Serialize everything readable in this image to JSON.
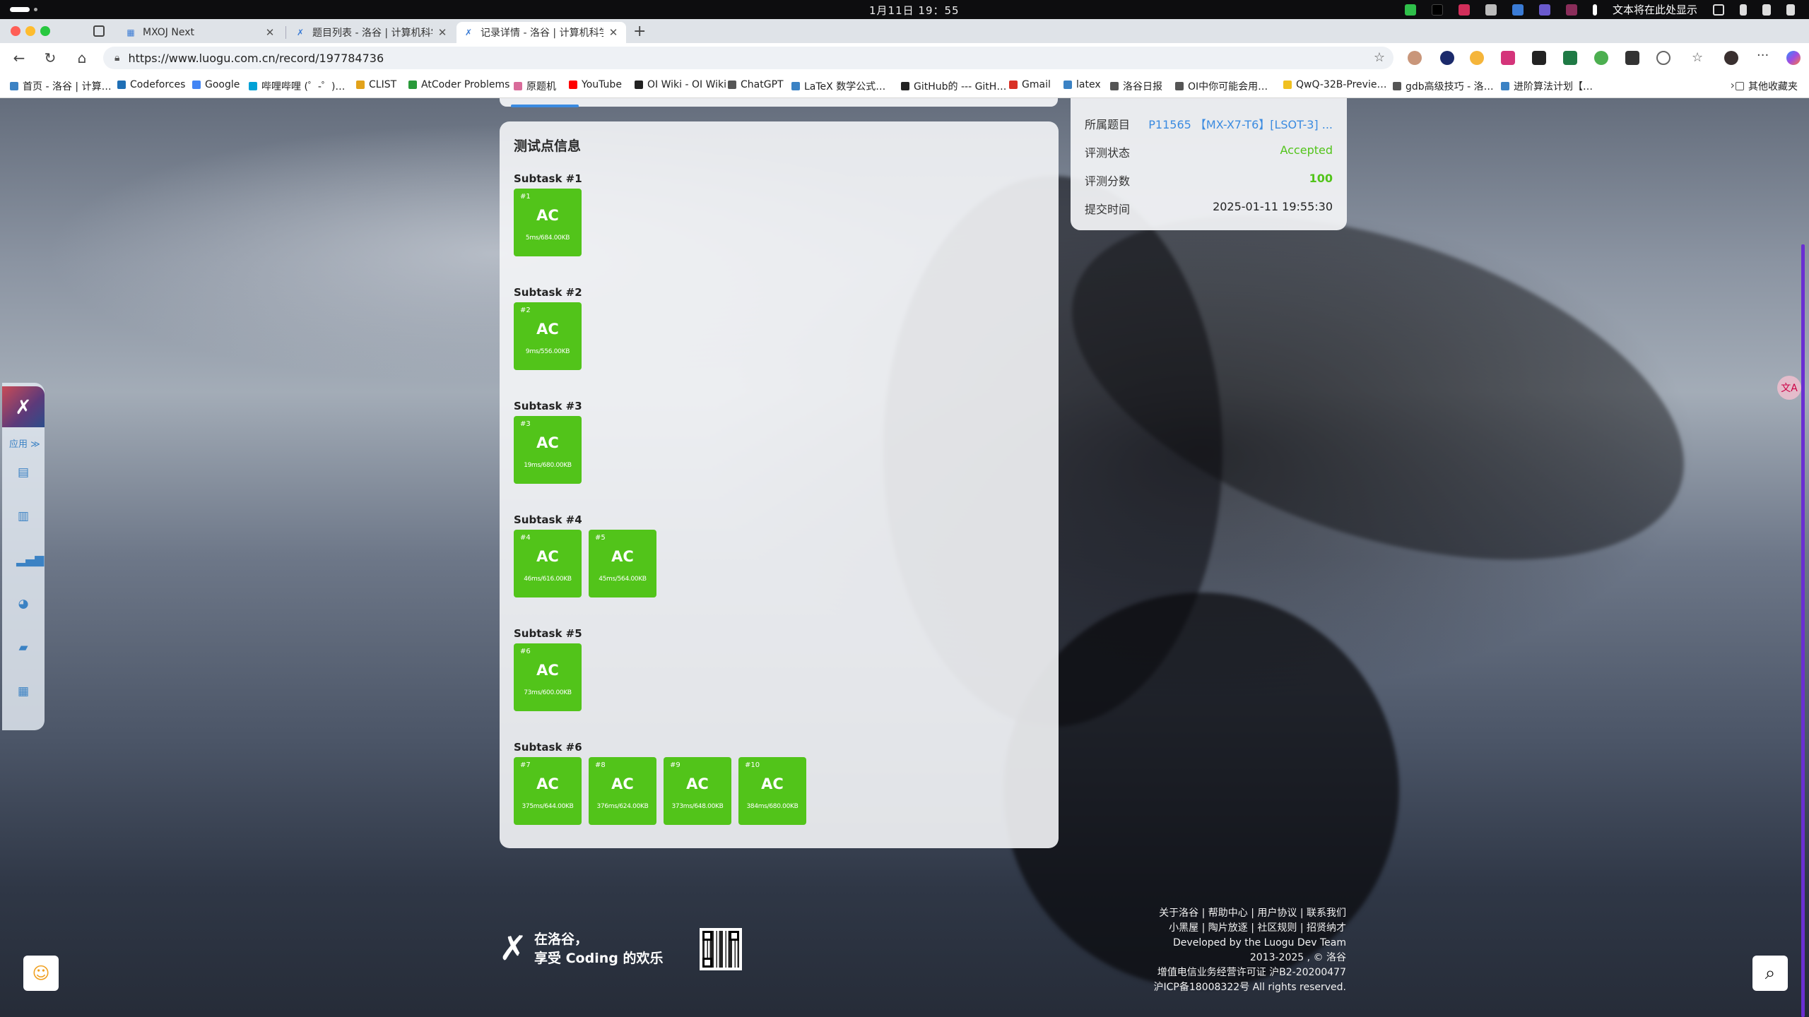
{
  "os": {
    "clock": "1月11日 19：55",
    "tray_text": "文本将在此处显示"
  },
  "tabs": [
    {
      "title": "MXOJ Next"
    },
    {
      "title": "题目列表 - 洛谷 | 计算机科学教"
    },
    {
      "title": "记录详情 - 洛谷 | 计算机科学教"
    }
  ],
  "address": {
    "url": "https://www.luogu.com.cn/record/197784736"
  },
  "bookmarks": [
    {
      "label": "首页 - 洛谷 | 计算…",
      "color": "#3b82c4"
    },
    {
      "label": "Codeforces",
      "color": "#1f6fb5"
    },
    {
      "label": "Google",
      "color": "#4285f4"
    },
    {
      "label": "哔哩哔哩 (゜-゜)…",
      "color": "#00a1d6"
    },
    {
      "label": "CLIST",
      "color": "#e2a21a"
    },
    {
      "label": "AtCoder Problems",
      "color": "#2a9a3a"
    },
    {
      "label": "原题机",
      "color": "#d96b9a"
    },
    {
      "label": "YouTube",
      "color": "#ff0000"
    },
    {
      "label": "OI Wiki - OI Wiki",
      "color": "#222222"
    },
    {
      "label": "ChatGPT",
      "color": "#555555"
    },
    {
      "label": "LaTeX 数学公式…",
      "color": "#3b82c4"
    },
    {
      "label": "GitHub的 --- GitH…",
      "color": "#222222"
    },
    {
      "label": "Gmail",
      "color": "#d93025"
    },
    {
      "label": "latex",
      "color": "#3b82c4"
    },
    {
      "label": "洛谷日报",
      "color": "#555555"
    },
    {
      "label": "OI中你可能会用…",
      "color": "#555555"
    },
    {
      "label": "QwQ-32B-Previe…",
      "color": "#f0c020"
    },
    {
      "label": "gdb高级技巧 - 洛…",
      "color": "#555555"
    },
    {
      "label": "进阶算法计划【…",
      "color": "#3b82c4"
    }
  ],
  "bookmarks_other": "其他收藏夹",
  "rail": {
    "app_label": "应用 ≫"
  },
  "testpoints": {
    "title": "测试点信息",
    "subtasks": [
      {
        "label": "Subtask #1",
        "cases": [
          {
            "id": "#1",
            "status": "AC",
            "meta": "5ms/684.00KB"
          }
        ]
      },
      {
        "label": "Subtask #2",
        "cases": [
          {
            "id": "#2",
            "status": "AC",
            "meta": "9ms/556.00KB"
          }
        ]
      },
      {
        "label": "Subtask #3",
        "cases": [
          {
            "id": "#3",
            "status": "AC",
            "meta": "19ms/680.00KB"
          }
        ]
      },
      {
        "label": "Subtask #4",
        "cases": [
          {
            "id": "#4",
            "status": "AC",
            "meta": "46ms/616.00KB"
          },
          {
            "id": "#5",
            "status": "AC",
            "meta": "45ms/564.00KB"
          }
        ]
      },
      {
        "label": "Subtask #5",
        "cases": [
          {
            "id": "#6",
            "status": "AC",
            "meta": "73ms/600.00KB"
          }
        ]
      },
      {
        "label": "Subtask #6",
        "cases": [
          {
            "id": "#7",
            "status": "AC",
            "meta": "375ms/644.00KB"
          },
          {
            "id": "#8",
            "status": "AC",
            "meta": "376ms/624.00KB"
          },
          {
            "id": "#9",
            "status": "AC",
            "meta": "373ms/648.00KB"
          },
          {
            "id": "#10",
            "status": "AC",
            "meta": "384ms/680.00KB"
          }
        ]
      }
    ]
  },
  "record_info": {
    "problem_key": "所属题目",
    "problem_value": "P11565 【MX-X7-T6】[LSOT-3] ...",
    "status_key": "评测状态",
    "status_value": "Accepted",
    "score_key": "评测分数",
    "score_value": "100",
    "time_key": "提交时间",
    "time_value": "2025-01-11 19:55:30"
  },
  "footer": {
    "slogan_line1": "在洛谷，",
    "slogan_line2": "享受 Coding 的欢乐",
    "links_line1": "关于洛谷 | 帮助中心 | 用户协议 | 联系我们",
    "links_line2": "小黑屋 | 陶片放逐 | 社区规则 | 招贤纳才",
    "dev_line": "Developed by the Luogu Dev Team",
    "copyright": "2013-2025 , © 洛谷",
    "license": "增值电信业务经营许可证 沪B2-20200477",
    "icp": "沪ICP备18008322号 All rights reserved."
  },
  "colors": {
    "ac_green": "#52c41a",
    "link_blue": "#3b8be0"
  }
}
